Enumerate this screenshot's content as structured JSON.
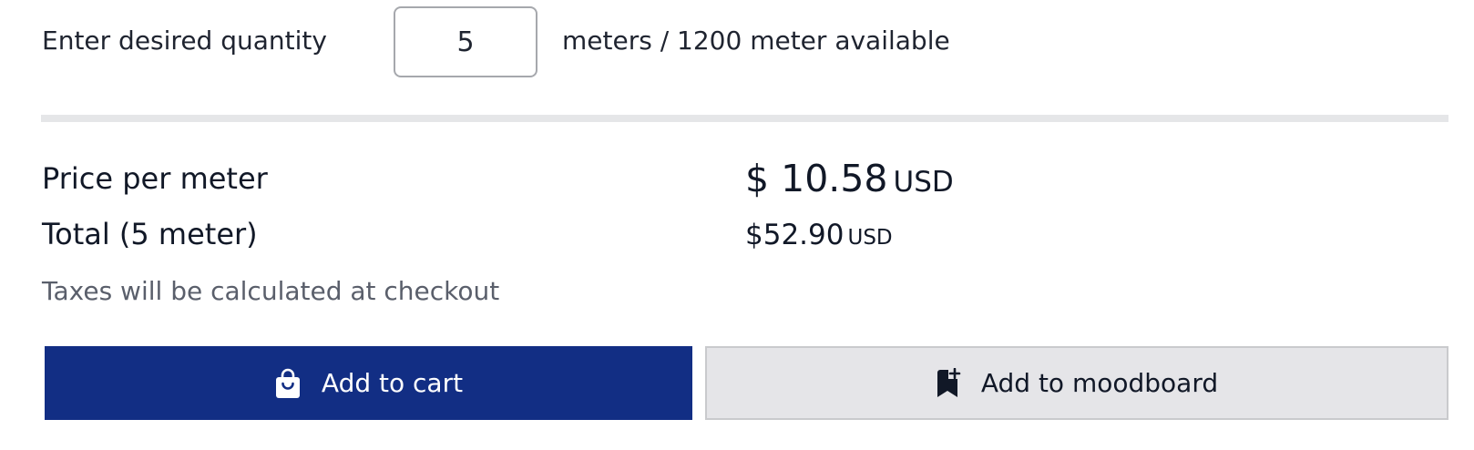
{
  "quantity": {
    "label": "Enter desired quantity",
    "value": "5",
    "unit_text": "meters / 1200 meter available"
  },
  "pricing": {
    "price_label": "Price per meter",
    "price_amount": "$ 10.58",
    "price_currency": "USD",
    "total_label": "Total (5 meter)",
    "total_amount": "$52.90",
    "total_currency": "USD",
    "tax_note": "Taxes will be calculated at checkout"
  },
  "actions": {
    "cart_label": "Add to cart",
    "cart_icon": "shopping-bag-icon",
    "moodboard_label": "Add to moodboard",
    "moodboard_icon": "bookmark-plus-icon"
  },
  "colors": {
    "primary": "#122e84",
    "secondary_bg": "#e5e5e8",
    "divider": "#e5e6e8"
  }
}
